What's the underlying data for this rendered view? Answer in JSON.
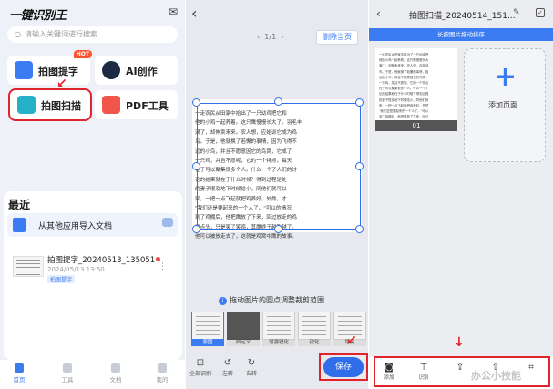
{
  "home": {
    "app_title": "一键识别王",
    "search_placeholder": "请输入关键词进行搜索",
    "tools": [
      {
        "label": "拍图提字",
        "badge": "HOT"
      },
      {
        "label": "AI创作"
      },
      {
        "label": "拍图扫描"
      },
      {
        "label": "PDF工具"
      }
    ],
    "recent_title": "最近",
    "import_label": "从其他应用导入文档",
    "doc": {
      "name": "拍图提字_20240513_135051",
      "date": "2024/05/13 13:50",
      "tag": "拍图提字"
    },
    "tabs": [
      "首页",
      "工具",
      "文档",
      "我的"
    ],
    "colors": {
      "accent": "#3b7cf3",
      "highlight": "#e0242c"
    }
  },
  "crop": {
    "pager": "1/1",
    "delete_label": "删除当页",
    "paper_lines": [
      "一走农民从田家中拾出了一只幼鸡把它和",
      "他的小鸡一起养着。这只鹰慢慢长大了。羽毛丰",
      "满了，却伸卖来来。农人想，应始训它成为鸡",
      "鸟。于是，他就换了若懈的事情，因为飞得不",
      "远的小鸟，并且不愿意因它的鸟窝，它成了",
      "一只鸡，并且不愿呢，它的一个特点，每天",
      "在于可以聚集很多个人。什么一个了人们的讨",
      "论的结果就在于什么时候？得到过程是处",
      "的妻子很及地下时候给小，同他们就可以",
      "家，一把一点飞起就把鸡养好。外然，才",
      "\"我们还是要起来的一个人了。\"可以的情况",
      "到了鸡棚后，他把鹰放了下来，回过放走的鸡",
      "鹰点头，只是笑了笑鸡，其鹰终于越飞越了。",
      "他可以被放走去了，这就是鸡窝中鹰的故事。"
    ],
    "hint": "拖动图片的圆点调整裁剪范围",
    "filters": [
      "原图",
      "自定义",
      "增强锐化",
      "锐化",
      "增亮"
    ],
    "controls": [
      "全部识别",
      "左转",
      "右转"
    ],
    "save_label": "保存"
  },
  "pages": {
    "title": "拍图扫描_20240514_151...",
    "banner": "长按图片拖动排序",
    "page_number": "01",
    "add_label": "添加页面",
    "tools": [
      "添加",
      "识别",
      "",
      "",
      ""
    ],
    "watermark": "办公小技能",
    "page_lines": [
      "一走农民从田家中拾出了一只幼鸡把",
      "他的小鸡一起养着。这只鹰慢慢长大",
      "满了，却伸卖来来。农人想，应始训",
      "鸟。于是，他就换了若懈的事情，因",
      "远的小鸟，并且不愿意因它的鸟窝",
      "一只鸡，并且不愿呢，它的一个特点",
      "在于可以聚集很多个人。什么一个了",
      "论的结果就在于什么时候？得到过程",
      "的妻子很及地下时候给小，同他们就",
      "家，一把一点飞起就把鸡养好。外然",
      "\"我们还是要起来的一个人了。\"可以",
      "到了鸡棚后，他把鹰放了下来，回过"
    ]
  }
}
